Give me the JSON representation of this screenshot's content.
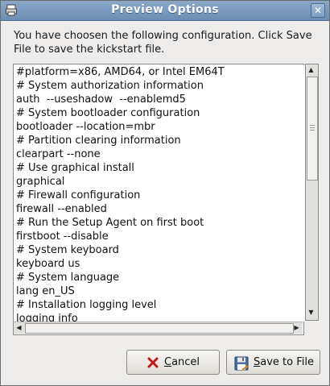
{
  "window": {
    "title": "Preview Options"
  },
  "intro": {
    "text": "You have choosen the following configuration. Click Save File to save the kickstart file."
  },
  "config_lines": [
    "#platform=x86, AMD64, or Intel EM64T",
    "# System authorization information",
    "auth  --useshadow  --enablemd5",
    "# System bootloader configuration",
    "bootloader --location=mbr",
    "# Partition clearing information",
    "clearpart --none",
    "# Use graphical install",
    "graphical",
    "# Firewall configuration",
    "firewall --enabled",
    "# Run the Setup Agent on first boot",
    "firstboot --disable",
    "# System keyboard",
    "keyboard us",
    "# System language",
    "lang en_US",
    "# Installation logging level",
    "logging info"
  ],
  "buttons": {
    "cancel": {
      "label": "Cancel",
      "mnemonic": "C"
    },
    "save": {
      "label": "Save to File",
      "mnemonic": "S"
    }
  },
  "icons": {
    "window": "printer-icon",
    "close": "close-icon",
    "cancel": "cancel-x-icon",
    "save": "floppy-disk-icon"
  }
}
